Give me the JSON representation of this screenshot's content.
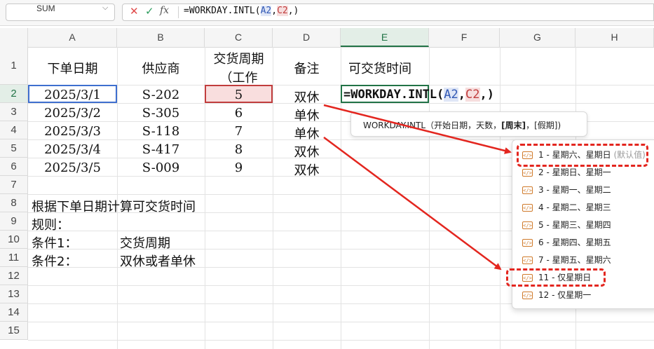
{
  "name_box": "SUM",
  "formula_bar": {
    "prefix": "=WORKDAY.INTL(",
    "ref_a2": "A2",
    "comma1": ",",
    "ref_c2": "C2",
    "suffix": ",)"
  },
  "columns": [
    "A",
    "B",
    "C",
    "D",
    "E",
    "F",
    "G",
    "H"
  ],
  "rows": [
    "1",
    "2",
    "3",
    "4",
    "5",
    "6",
    "7",
    "8",
    "9",
    "10",
    "11",
    "12",
    "13",
    "14",
    "15"
  ],
  "header": {
    "a1": "下单日期",
    "b1": "供应商",
    "c1_line1": "交货周期",
    "c1_line2": "（工作",
    "d1": "备注",
    "e1": "可交货时间"
  },
  "table": [
    {
      "date": "2025/3/1",
      "supplier": "S-202",
      "period": "5",
      "note": "双休"
    },
    {
      "date": "2025/3/2",
      "supplier": "S-305",
      "period": "6",
      "note": "单休"
    },
    {
      "date": "2025/3/3",
      "supplier": "S-118",
      "period": "7",
      "note": "单休"
    },
    {
      "date": "2025/3/4",
      "supplier": "S-417",
      "period": "8",
      "note": "双休"
    },
    {
      "date": "2025/3/5",
      "supplier": "S-009",
      "period": "9",
      "note": "双休"
    }
  ],
  "notes": {
    "r8": "根据下单日期计算可交货时间",
    "r9": "规则：",
    "r10_a": "条件1：",
    "r10_b": "交货周期",
    "r11_a": "条件2：",
    "r11_b": "双休或者单休"
  },
  "edit_cell": {
    "prefix": "=WORKDAY.INTL(",
    "ref_a2": "A2",
    "comma1": ",",
    "ref_c2": "C2",
    "suffix": ",)"
  },
  "tooltip": {
    "func": "WORKDAY.INTL",
    "open": "（开始日期，天数，",
    "weekend": "[周末]",
    "close": "，[假期])"
  },
  "weekend_options": [
    {
      "label": "1 - 星期六、星期日",
      "hint": "(默认值)"
    },
    {
      "label": "2 - 星期日、星期一",
      "hint": ""
    },
    {
      "label": "3 - 星期一、星期二",
      "hint": ""
    },
    {
      "label": "4 - 星期二、星期三",
      "hint": ""
    },
    {
      "label": "5 - 星期三、星期四",
      "hint": ""
    },
    {
      "label": "6 - 星期四、星期五",
      "hint": ""
    },
    {
      "label": "7 - 星期五、星期六",
      "hint": ""
    },
    {
      "label": "11 - 仅星期日",
      "hint": ""
    },
    {
      "label": "12 - 仅星期一",
      "hint": ""
    }
  ],
  "colors": {
    "accent_green": "#217346",
    "ref_blue": "#3e6fcf",
    "ref_red": "#c13d3d",
    "annotation_red": "#e3261f"
  }
}
